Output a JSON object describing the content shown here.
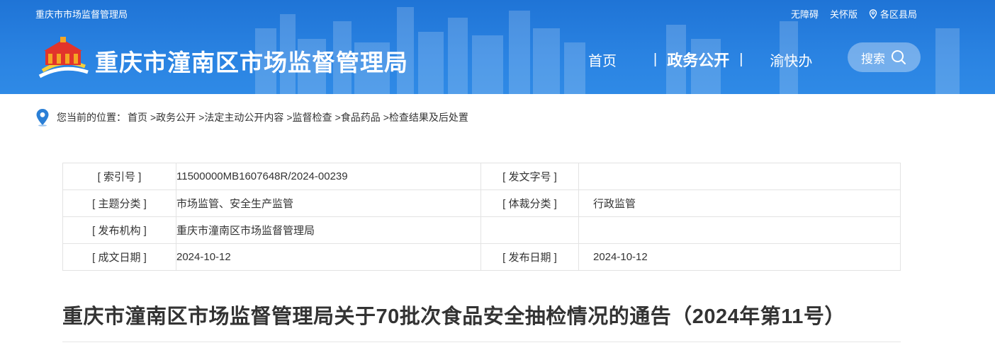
{
  "header": {
    "site_small": "重庆市市场监督管理局",
    "site_title": "重庆市潼南区市场监督管理局",
    "top_links": {
      "accessibility": "无障碍",
      "senior": "关怀版",
      "districts": "各区县局"
    },
    "nav": {
      "home": "首页",
      "open_gov": "政务公开",
      "yukuaiban": "渝快办",
      "sep": "|"
    },
    "search_label": "搜索"
  },
  "breadcrumb": {
    "lead": "您当前的位置：",
    "items": [
      "首页",
      ">政务公开",
      ">法定主动公开内容",
      ">监督检查",
      ">食品药品",
      ">检查结果及后处置"
    ]
  },
  "info_table": {
    "rows": [
      {
        "k1": "[ 索引号 ]",
        "v1": "11500000MB1607648R/2024-00239",
        "k2": "[ 发文字号 ]",
        "v2": ""
      },
      {
        "k1": "[ 主题分类 ]",
        "v1": "市场监管、安全生产监管",
        "k2": "[ 体裁分类 ]",
        "v2": "行政监管"
      },
      {
        "k1": "[ 发布机构 ]",
        "v1": "重庆市潼南区市场监督管理局",
        "k2": "",
        "v2": ""
      },
      {
        "k1": "[ 成文日期 ]",
        "v1": "2024-10-12",
        "k2": "[ 发布日期 ]",
        "v2": "2024-10-12"
      }
    ]
  },
  "article": {
    "title": "重庆市潼南区市场监督管理局关于70批次食品安全抽检情况的通告（2024年第11号）"
  },
  "colors": {
    "header_blue": "#2a83e2",
    "breadcrumb_pin": "#2a7fd6"
  },
  "icons": {
    "logo": "emblem-logo",
    "location": "location-pin-icon",
    "search": "search-icon"
  }
}
